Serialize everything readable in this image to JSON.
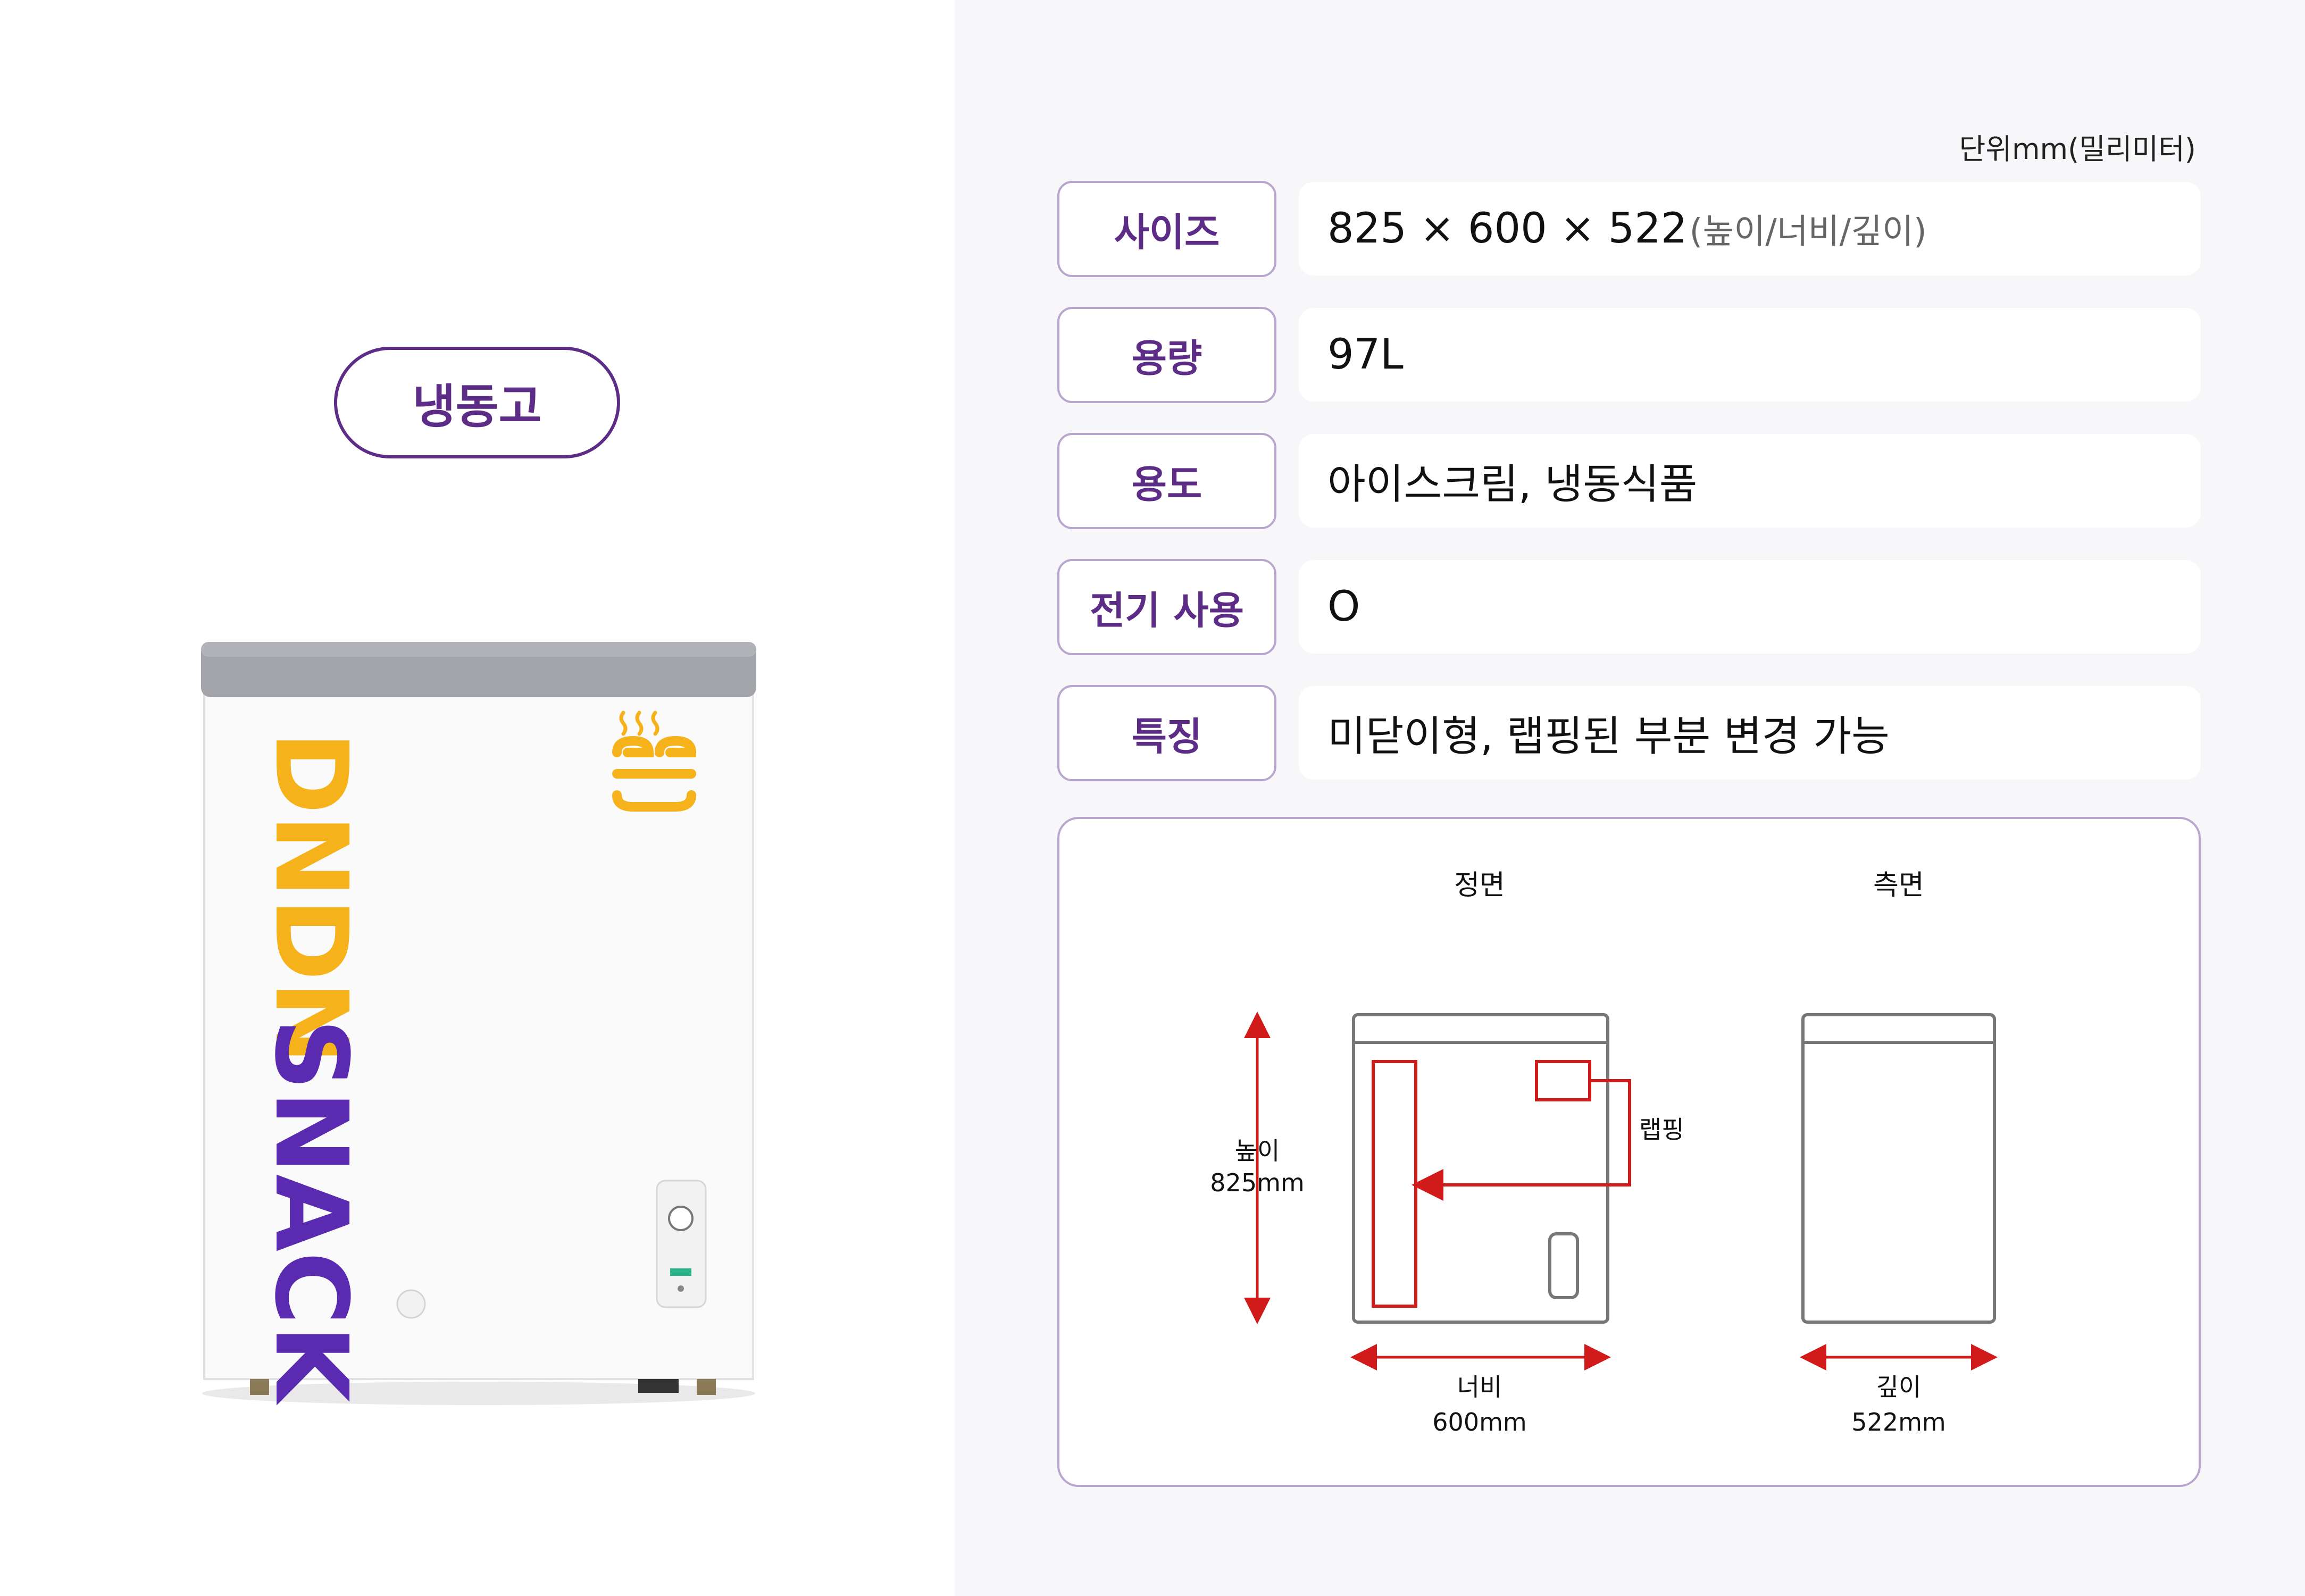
{
  "product": {
    "title": "냉동고",
    "brand_part1": "DNDN",
    "brand_part2": "SNACK",
    "brand_colors": {
      "yellow": "#f5b21b",
      "purple": "#5a2bb0"
    }
  },
  "spec": {
    "unit_note": "단위mm(밀리미터)",
    "rows": [
      {
        "label": "사이즈",
        "value": "825 × 600 × 522",
        "note": "(높이/너비/깊이)"
      },
      {
        "label": "용량",
        "value": "97L",
        "note": ""
      },
      {
        "label": "용도",
        "value": "아이스크림, 냉동식품",
        "note": ""
      },
      {
        "label": "전기 사용",
        "value": "O",
        "note": ""
      },
      {
        "label": "특징",
        "value": "미닫이형, 랩핑된 부분 변경 가능",
        "note": ""
      }
    ]
  },
  "diagram": {
    "front_label": "정면",
    "side_label": "측면",
    "height_label": "높이",
    "height_value": "825mm",
    "width_label": "너비",
    "width_value": "600mm",
    "depth_label": "깊이",
    "depth_value": "522mm",
    "wrap_label": "랩핑",
    "colors": {
      "wrap": "#d11a1a",
      "outline": "#777777"
    }
  },
  "colors": {
    "accent": "#5c2c86",
    "border": "#b9a6cf",
    "panel": "#f7f7fa"
  }
}
